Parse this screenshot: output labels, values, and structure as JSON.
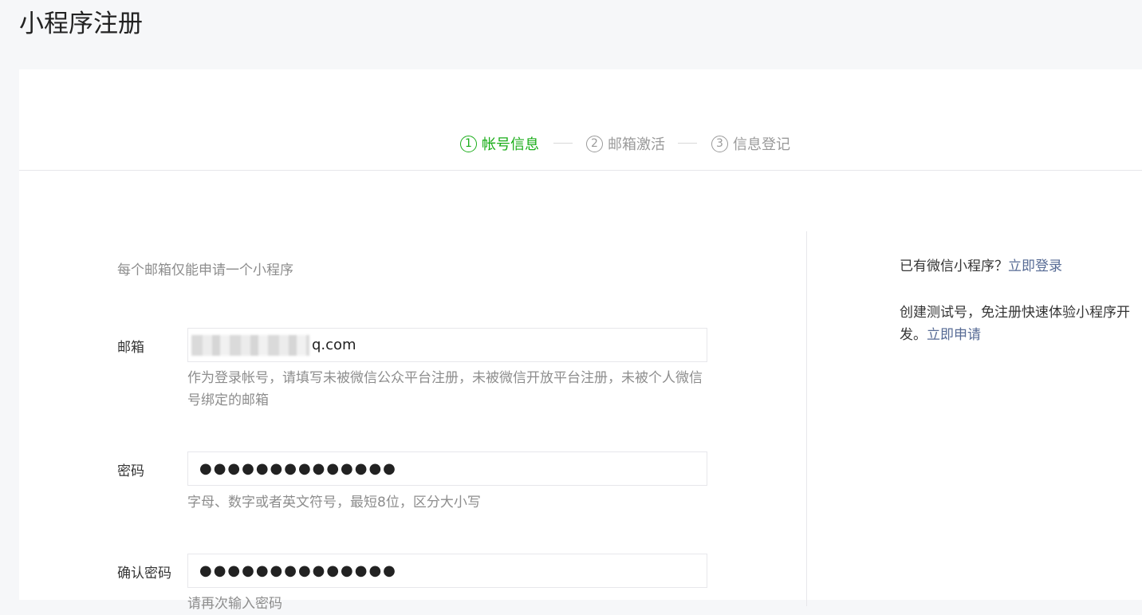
{
  "page": {
    "title": "小程序注册"
  },
  "steps": [
    {
      "num": "1",
      "label": "帐号信息"
    },
    {
      "num": "2",
      "label": "邮箱激活"
    },
    {
      "num": "3",
      "label": "信息登记"
    }
  ],
  "form": {
    "tip": "每个邮箱仅能申请一个小程序",
    "email": {
      "label": "邮箱",
      "value_visible_suffix": "q.com",
      "hint": "作为登录帐号，请填写未被微信公众平台注册，未被微信开放平台注册，未被个人微信号绑定的邮箱"
    },
    "password": {
      "label": "密码",
      "value": "●●●●●●●●●●●●●●",
      "hint": "字母、数字或者英文符号，最短8位，区分大小写"
    },
    "confirm_password": {
      "label": "确认密码",
      "value": "●●●●●●●●●●●●●●",
      "hint": "请再次输入密码"
    }
  },
  "side": {
    "has_account_text": "已有微信小程序？",
    "login_link": "立即登录",
    "test_account_text": "创建测试号，免注册快速体验小程序开发。",
    "apply_link": "立即申请"
  },
  "colors": {
    "active_step": "#1aad19",
    "link": "#576b95",
    "hint": "#8d8d8d"
  }
}
